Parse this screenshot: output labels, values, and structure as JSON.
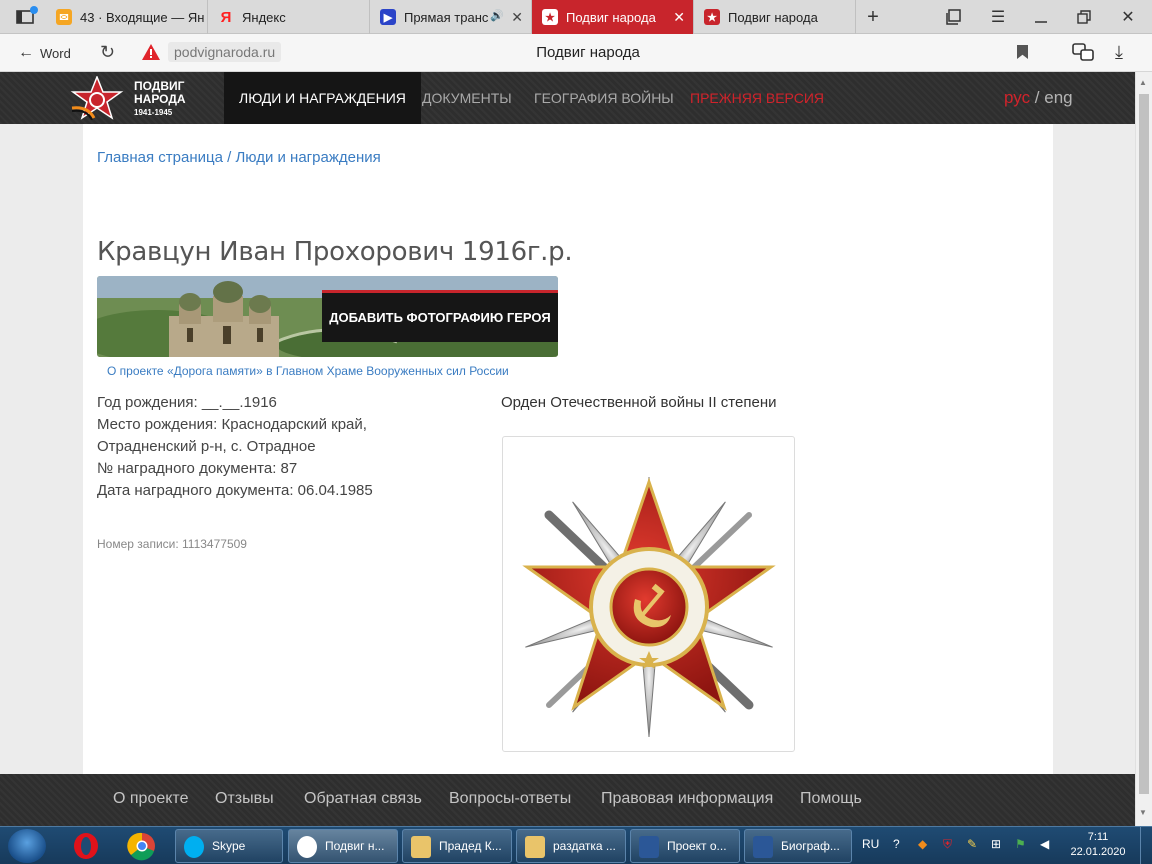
{
  "browser": {
    "tabs": [
      {
        "label": "43 · Входящие — Ян",
        "favicon": "mail-icon",
        "color": "#f5a623"
      },
      {
        "label": "Яндекс",
        "favicon": "yandex-icon",
        "color": "#ff0000"
      },
      {
        "label": "Прямая транс",
        "favicon": "tv-icon",
        "color": "#2b44c8"
      },
      {
        "label": "Подвиг народа",
        "favicon": "star-icon",
        "color": "#c8252c",
        "active": true
      },
      {
        "label": "Подвиг народа",
        "favicon": "star-icon",
        "color": "#c8252c"
      }
    ],
    "back_label": "Word",
    "domain": "podvignaroda.ru",
    "page_title": "Подвиг народа"
  },
  "site": {
    "logo": {
      "line1": "ПОДВИГ",
      "line2": "НАРОДА",
      "years": "1941-1945"
    },
    "nav": [
      {
        "label": "Люди и награждения",
        "active": true
      },
      {
        "label": "Документы"
      },
      {
        "label": "География войны"
      },
      {
        "label": "Прежняя версия",
        "accent": true
      }
    ],
    "lang": {
      "ru": "рус",
      "sep": " / ",
      "en": "eng"
    }
  },
  "breadcrumb": {
    "home": "Главная страница",
    "sep": " / ",
    "current": "Люди и награждения"
  },
  "person": {
    "title": "Кравцун Иван Прохорович 1916г.р.",
    "banner_button": "ДОБАВИТЬ ФОТОГРАФИЮ ГЕРОЯ",
    "banner_link": "О проекте «Дорога памяти» в Главном Храме Вооруженных сил России",
    "birth_year": "Год рождения: __.__.1916",
    "birthplace_1": "Место рождения: Краснодарский край,",
    "birthplace_2": "Отрадненский р-н, с. Отрадное",
    "award_doc_no": "№ наградного документа: 87",
    "award_doc_date": "Дата наградного документа: 06.04.1985",
    "record_no": "Номер записи: 1113477509",
    "award_name": "Орден Отечественной войны II степени"
  },
  "footer": [
    "О проекте",
    "Отзывы",
    "Обратная связь",
    "Вопросы-ответы",
    "Правовая информация",
    "Помощь"
  ],
  "taskbar": {
    "buttons": [
      {
        "label": "Skype",
        "color": "#00aff0"
      },
      {
        "label": "Подвиг н...",
        "color": "#e0e0e0",
        "active": true
      },
      {
        "label": "Прадед К...",
        "color": "#e9c46a"
      },
      {
        "label": "раздатка ...",
        "color": "#e9c46a"
      },
      {
        "label": "Проект о...",
        "color": "#2b5797"
      },
      {
        "label": "Биограф...",
        "color": "#2b5797"
      }
    ],
    "lang": "RU",
    "time": "7:11",
    "date": "22.01.2020"
  }
}
